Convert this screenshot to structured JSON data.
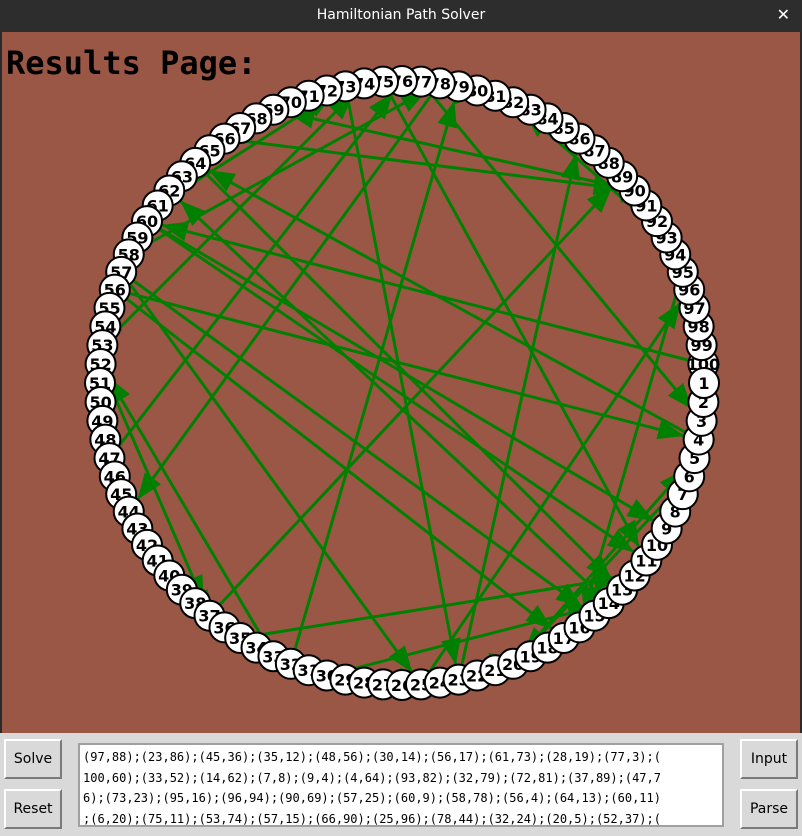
{
  "window": {
    "title": "Hamiltonian Path Solver",
    "close_glyph": "✕"
  },
  "results": {
    "heading": "Results Page:"
  },
  "buttons": {
    "solve": "Solve",
    "reset": "Reset",
    "input": "Input",
    "parse": "Parse"
  },
  "edge_text": [
    "(97,88);(23,86);(45,36);(35,12);(48,56);(30,14);(56,17);(61,73);(28,19);(77,3);(",
    "100,60);(33,52);(14,62);(7,8);(9,4);(4,64);(93,82);(32,79);(72,81);(37,89);(47,7",
    "6);(73,23);(95,16);(96,94);(90,69);(57,25);(60,9);(58,78);(56,4);(64,13);(60,11)",
    ";(6,20);(75,11);(53,74);(57,15);(66,90);(25,96);(78,44);(32,24);(20,5);(52,37);("
  ],
  "graph": {
    "node_count": 100,
    "edges": [
      [
        97,
        88
      ],
      [
        23,
        86
      ],
      [
        45,
        36
      ],
      [
        35,
        12
      ],
      [
        48,
        56
      ],
      [
        30,
        14
      ],
      [
        56,
        17
      ],
      [
        61,
        73
      ],
      [
        28,
        19
      ],
      [
        77,
        3
      ],
      [
        100,
        60
      ],
      [
        33,
        52
      ],
      [
        14,
        62
      ],
      [
        7,
        8
      ],
      [
        9,
        4
      ],
      [
        4,
        64
      ],
      [
        93,
        82
      ],
      [
        32,
        79
      ],
      [
        72,
        81
      ],
      [
        37,
        89
      ],
      [
        47,
        76
      ],
      [
        73,
        23
      ],
      [
        95,
        16
      ],
      [
        96,
        94
      ],
      [
        90,
        69
      ],
      [
        57,
        25
      ],
      [
        60,
        9
      ],
      [
        58,
        78
      ],
      [
        56,
        4
      ],
      [
        64,
        13
      ],
      [
        60,
        11
      ],
      [
        6,
        20
      ],
      [
        75,
        11
      ],
      [
        53,
        74
      ],
      [
        57,
        15
      ],
      [
        66,
        90
      ],
      [
        25,
        96
      ],
      [
        78,
        44
      ],
      [
        32,
        24
      ],
      [
        20,
        5
      ],
      [
        52,
        37
      ]
    ],
    "colors": {
      "background": "#9b5746",
      "edge": "#008000",
      "node_fill": "#ffffff",
      "node_stroke": "#000000"
    }
  }
}
